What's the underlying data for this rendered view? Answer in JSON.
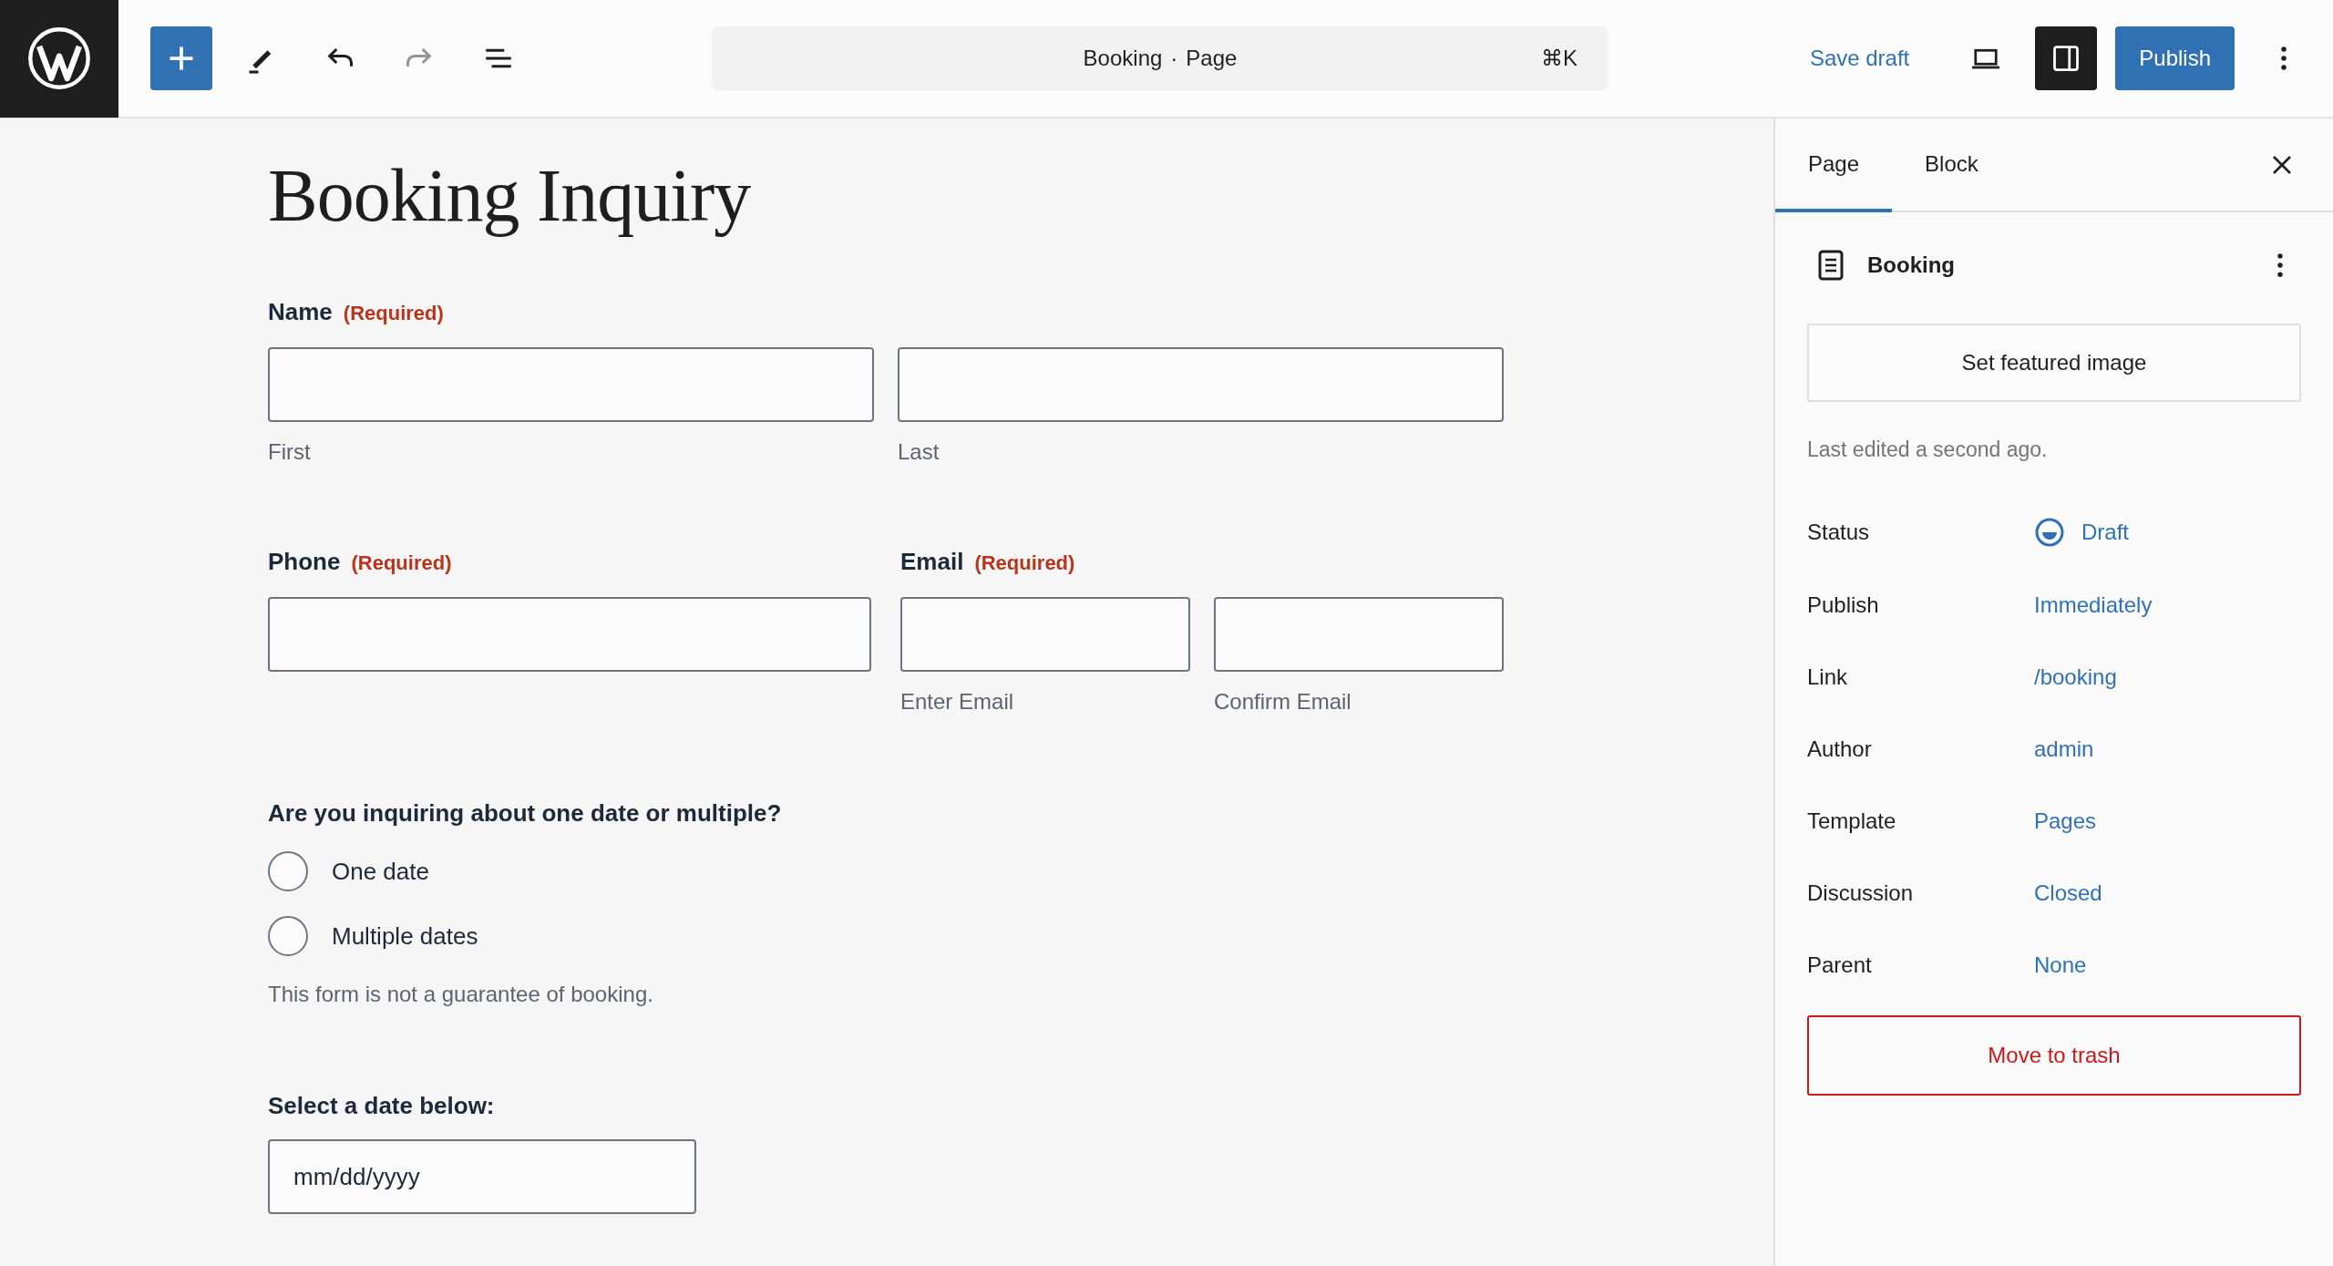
{
  "topbar": {
    "tools": [
      {
        "kind": "inserter",
        "disabled": false
      },
      {
        "kind": "tools",
        "disabled": false
      },
      {
        "kind": "undo",
        "disabled": false
      },
      {
        "kind": "redo",
        "disabled": true
      },
      {
        "kind": "list-view",
        "disabled": false
      }
    ],
    "command": {
      "title": "Booking",
      "separator": "·",
      "type": "Page",
      "shortcut": "⌘K"
    },
    "save_draft": "Save draft",
    "settings_on": true,
    "publish": "Publish"
  },
  "editor": {
    "title": "Booking Inquiry",
    "blocks": [
      {
        "kind": "fields",
        "groups": [
          {
            "label": "Name",
            "required": "(Required)",
            "inputs": [
              {
                "sublabel": "First"
              },
              {
                "sublabel": "Last"
              }
            ]
          }
        ]
      },
      {
        "kind": "fields",
        "groups": [
          {
            "label": "Phone",
            "required": "(Required)"
          },
          {
            "label": "Email",
            "required": "(Required)",
            "inputs": [
              {
                "sublabel": "Enter Email"
              },
              {
                "sublabel": "Confirm Email"
              }
            ]
          }
        ]
      },
      {
        "kind": "choice",
        "question": "Are you inquiring about one date or multiple?",
        "options": [
          {
            "label": "One date",
            "selected": false
          },
          {
            "label": "Multiple dates",
            "selected": false
          }
        ]
      },
      {
        "kind": "note",
        "text": "This form is not a guarantee of booking."
      },
      {
        "kind": "date",
        "label": "Select a date below:",
        "placeholder": "mm/dd/yyyy"
      }
    ]
  },
  "sidebar": {
    "tabs": [
      {
        "label": "Page",
        "selected": true
      },
      {
        "label": "Block",
        "selected": false
      }
    ],
    "page_title": "Booking",
    "featured_image_button": "Set featured image",
    "last_edited": "Last edited a second ago.",
    "rows": [
      {
        "label": "Status",
        "value": "Draft",
        "kind": "status"
      },
      {
        "label": "Publish",
        "value": "Immediately"
      },
      {
        "label": "Link",
        "value": "/booking"
      },
      {
        "label": "Author",
        "value": "admin"
      },
      {
        "label": "Template",
        "value": "Pages"
      },
      {
        "label": "Discussion",
        "value": "Closed"
      },
      {
        "label": "Parent",
        "value": "None"
      }
    ],
    "trash_button": "Move to trash"
  }
}
